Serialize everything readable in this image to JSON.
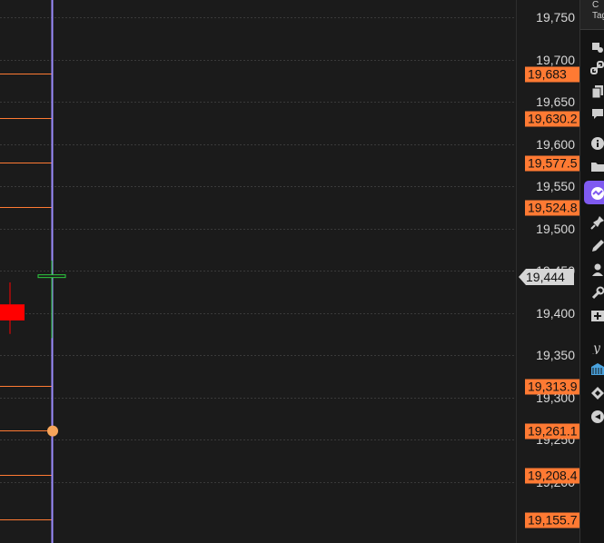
{
  "price_axis": {
    "ticks": [
      "19,750",
      "19,700",
      "19,650",
      "19,600",
      "19,550",
      "19,500",
      "19,450",
      "19,400",
      "19,350",
      "19,300",
      "19,250",
      "19,200"
    ],
    "level_tags": [
      "19,683",
      "19,630.2",
      "19,577.5",
      "19,524.8",
      "19,313.9",
      "19,261.1",
      "19,208.4",
      "19,155.7"
    ],
    "last_price": "19,444",
    "level_color": "#ff7a33",
    "last_price_color": "#d6d6d6"
  },
  "chart": {
    "levels": [
      19683,
      19630.2,
      19577.5,
      19524.8,
      19313.9,
      19261.1,
      19208.4,
      19155.7
    ],
    "candles": [
      {
        "open": 19410,
        "high": 19436,
        "low": 19375,
        "close": 19391,
        "color": "#ff0000"
      },
      {
        "open": 19445,
        "high": 19462,
        "low": 19370,
        "close": 19442,
        "color": "#2ecc40"
      }
    ],
    "cursor_price": 19261.1,
    "vertical_line_color": "#9c8cff",
    "grid": true
  },
  "toolbar": {
    "top_labels": [
      "C",
      "Tag"
    ],
    "icons": [
      "alert-settings-icon",
      "link-icon",
      "copy-icon",
      "comment-icon",
      "info-icon",
      "folder-icon",
      "indicator-icon",
      "pin-icon",
      "pen-icon",
      "user-icon",
      "wrench-icon",
      "add-panel-icon",
      "yahoo-icon",
      "bank-icon",
      "diamond-icon",
      "send-icon"
    ]
  }
}
